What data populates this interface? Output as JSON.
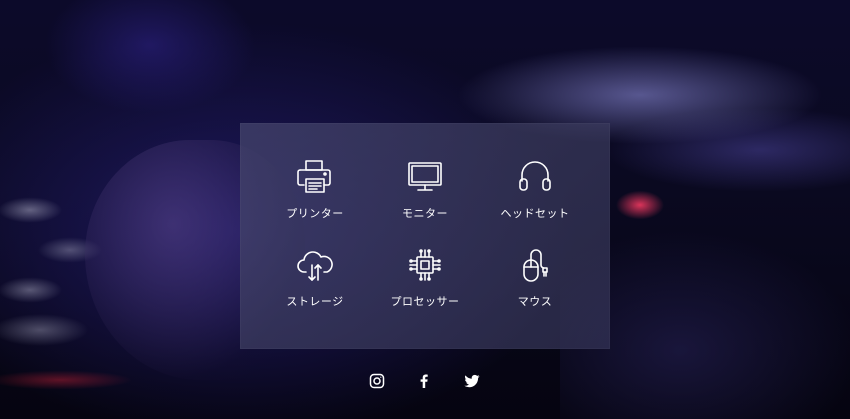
{
  "categories": [
    {
      "label": "プリンター",
      "icon": "printer-icon"
    },
    {
      "label": "モニター",
      "icon": "monitor-icon"
    },
    {
      "label": "ヘッドセット",
      "icon": "headset-icon"
    },
    {
      "label": "ストレージ",
      "icon": "cloud-storage-icon"
    },
    {
      "label": "プロセッサー",
      "icon": "processor-icon"
    },
    {
      "label": "マウス",
      "icon": "mouse-icon"
    }
  ],
  "social": [
    {
      "icon": "instagram-icon"
    },
    {
      "icon": "facebook-icon"
    },
    {
      "icon": "twitter-icon"
    }
  ],
  "colors": {
    "panel": "#3f3f66",
    "text": "#ffffff",
    "background": "#0a0920"
  }
}
